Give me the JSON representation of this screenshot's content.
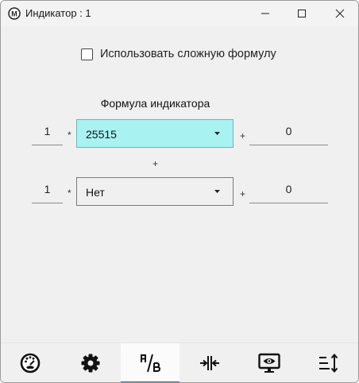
{
  "window": {
    "title": "Индикатор : 1",
    "app_icon_letter": "M"
  },
  "formula": {
    "use_complex_label": "Использовать сложную формулу",
    "use_complex_checked": false,
    "title": "Формула индикатора",
    "rows": [
      {
        "coefficient": "1",
        "multiply_op": "*",
        "source": "25515",
        "plus_op": "+",
        "offset": "0"
      },
      {
        "coefficient": "1",
        "multiply_op": "*",
        "source": "Нет",
        "plus_op": "+",
        "offset": "0"
      }
    ],
    "between_op": "+"
  },
  "bottom_nav": {
    "tabs": [
      {
        "icon": "gauge-icon"
      },
      {
        "icon": "gear-icon"
      },
      {
        "icon": "a-over-b-icon",
        "selected": true
      },
      {
        "icon": "align-center-icon"
      },
      {
        "icon": "monitor-eye-icon"
      },
      {
        "icon": "sort-height-icon"
      }
    ]
  },
  "colors": {
    "active_select": "#a9f2f2",
    "selected_tab_indicator": "#3a6ea8"
  }
}
